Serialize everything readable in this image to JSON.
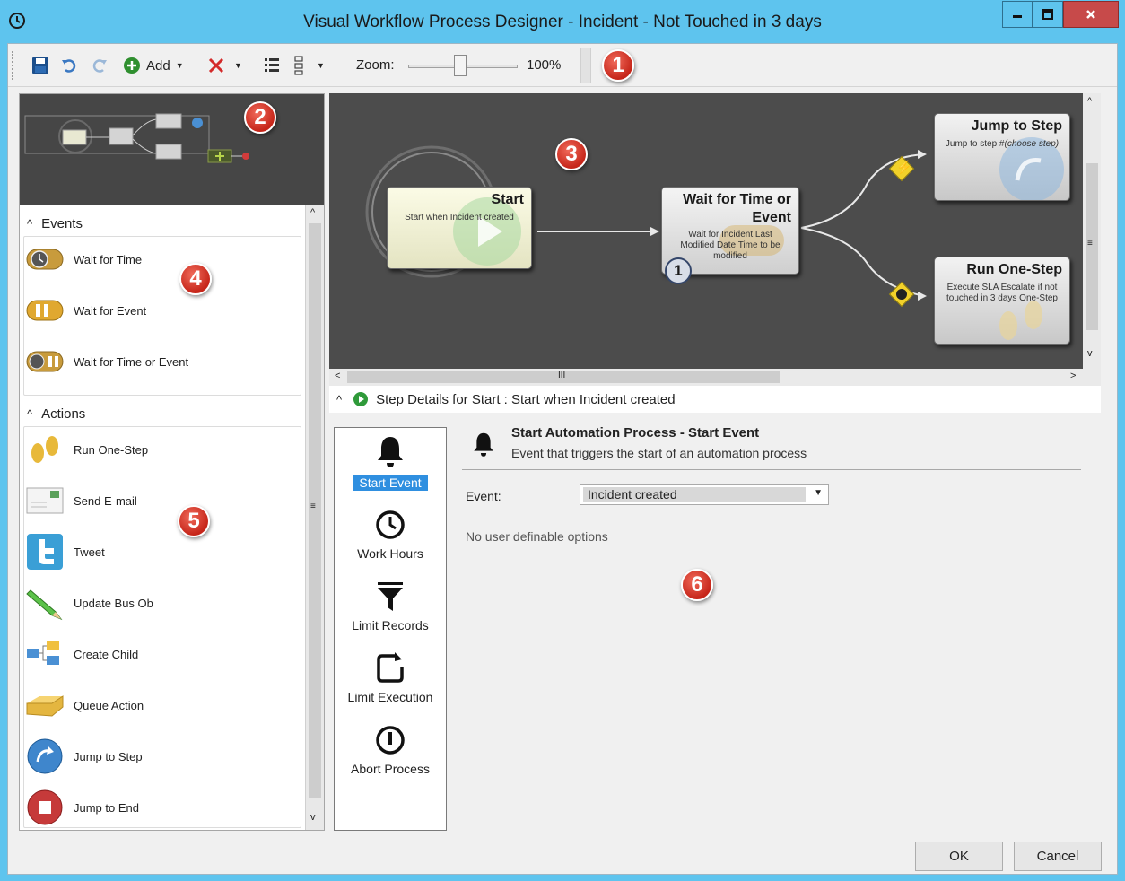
{
  "window": {
    "title": "Visual Workflow Process Designer - Incident -  Not Touched in 3 days",
    "minimize_icon": "minimize-icon",
    "maximize_icon": "maximize-icon",
    "close_icon": "close-icon"
  },
  "toolbar": {
    "add_label": "Add",
    "zoom_label": "Zoom:",
    "zoom_value": "100%",
    "zoom_level_percent": 100
  },
  "callouts": [
    "1",
    "2",
    "3",
    "4",
    "5",
    "6"
  ],
  "palette": {
    "events_header": "Events",
    "events": [
      {
        "label": "Wait for Time",
        "icon": "clock-icon"
      },
      {
        "label": "Wait for Event",
        "icon": "pause-icon"
      },
      {
        "label": "Wait for Time or Event",
        "icon": "clock-pause-icon"
      }
    ],
    "actions_header": "Actions",
    "actions": [
      {
        "label": "Run One-Step",
        "icon": "footprints-icon"
      },
      {
        "label": "Send E-mail",
        "icon": "envelope-icon"
      },
      {
        "label": "Tweet",
        "icon": "twitter-icon"
      },
      {
        "label": "Update Bus Ob",
        "icon": "pencil-icon"
      },
      {
        "label": "Create Child",
        "icon": "hierarchy-icon"
      },
      {
        "label": "Queue Action",
        "icon": "tray-icon"
      },
      {
        "label": "Jump to Step",
        "icon": "jump-arrow-icon"
      },
      {
        "label": "Jump to End",
        "icon": "stop-icon"
      }
    ]
  },
  "canvas": {
    "nodes": {
      "start": {
        "title": "Start",
        "desc": "Start when Incident created"
      },
      "wait": {
        "title_line1": "Wait for Time or",
        "title_line2": "Event",
        "desc_line1": "Wait for Incident.Last",
        "desc_line2": "Modified Date Time to be",
        "desc_line3": "modified",
        "badge": "1"
      },
      "jump": {
        "title": "Jump to Step",
        "desc_prefix": "Jump to step #",
        "desc_choose": "(choose step)"
      },
      "run": {
        "title": "Run One-Step",
        "desc_line1": "Execute SLA Escalate if not",
        "desc_line2": "touched in 3 days One-Step"
      }
    }
  },
  "details": {
    "header": "Step Details for Start : Start when Incident created",
    "tabs": [
      {
        "label": "Start Event",
        "icon": "bell-icon",
        "active": true
      },
      {
        "label": "Work Hours",
        "icon": "clock-icon",
        "active": false
      },
      {
        "label": "Limit Records",
        "icon": "funnel-icon",
        "active": false
      },
      {
        "label": "Limit Execution",
        "icon": "limit-arrow-icon",
        "active": false
      },
      {
        "label": "Abort Process",
        "icon": "abort-icon",
        "active": false
      }
    ],
    "title": "Start Automation Process - Start Event",
    "subtitle": "Event that triggers the start of an automation process",
    "event_label": "Event:",
    "event_value": "Incident created",
    "no_options": "No user definable options"
  },
  "footer": {
    "ok_label": "OK",
    "cancel_label": "Cancel"
  },
  "colors": {
    "title_bar": "#5ec4ee",
    "canvas_bg": "#4c4c4c",
    "active_tab": "#2f8fe0",
    "callout_red": "#d8372a"
  }
}
